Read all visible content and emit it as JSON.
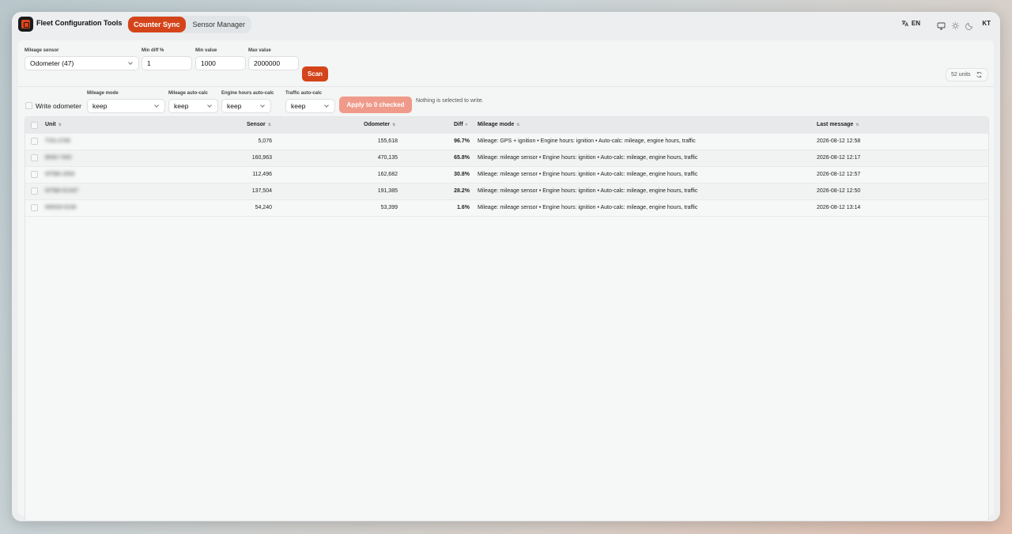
{
  "app": {
    "title": "Fleet Configuration Tools"
  },
  "tabs": [
    {
      "label": "Counter Sync",
      "active": true
    },
    {
      "label": "Sensor Manager",
      "active": false
    }
  ],
  "topbar": {
    "language": "EN",
    "avatar": "KT"
  },
  "filters": {
    "mileage_sensor": {
      "label": "Mileage sensor",
      "value": "Odometer (47)"
    },
    "min_diff": {
      "label": "Min diff %",
      "value": "1"
    },
    "min_value": {
      "label": "Min value",
      "value": "1000"
    },
    "max_value": {
      "label": "Max value",
      "value": "2000000"
    },
    "scan_label": "Scan",
    "units_count": "52 units"
  },
  "write": {
    "write_odometer_label": "Write odometer",
    "mileage_mode": {
      "label": "Mileage mode",
      "value": "keep"
    },
    "mileage_autocalc": {
      "label": "Mileage auto-calc",
      "value": "keep"
    },
    "engine_hours_autocalc": {
      "label": "Engine hours auto-calc",
      "value": "keep"
    },
    "traffic_autocalc": {
      "label": "Traffic auto-calc",
      "value": "keep"
    },
    "apply_label": "Apply to 0 checked",
    "status": "Nothing is selected to write."
  },
  "table": {
    "headers": {
      "unit": "Unit",
      "sensor": "Sensor",
      "odometer": "Odometer",
      "diff": "Diff",
      "mileage_mode": "Mileage mode",
      "last_message": "Last message"
    },
    "rows": [
      {
        "unit": "TSN-3788",
        "sensor": "5,076",
        "odometer": "155,618",
        "diff": "96.7%",
        "mode": "Mileage: GPS + ignition • Engine hours: ignition • Auto-calc: mileage, engine hours, traffic",
        "last": "2026-08-12 12:58"
      },
      {
        "unit": "BNM-7483",
        "sensor": "160,963",
        "odometer": "470,135",
        "diff": "65.8%",
        "mode": "Mileage: mileage sensor • Engine hours: ignition • Auto-calc: mileage, engine hours, traffic",
        "last": "2026-08-12 12:17"
      },
      {
        "unit": "MTBB-2856",
        "sensor": "112,496",
        "odometer": "162,682",
        "diff": "30.8%",
        "mode": "Mileage: mileage sensor • Engine hours: ignition • Auto-calc: mileage, engine hours, traffic",
        "last": "2026-08-12 12:57"
      },
      {
        "unit": "MTBB-R2497",
        "sensor": "137,504",
        "odometer": "191,385",
        "diff": "28.2%",
        "mode": "Mileage: mileage sensor • Engine hours: ignition • Auto-calc: mileage, engine hours, traffic",
        "last": "2026-08-12 12:50"
      },
      {
        "unit": "MRKM-6248",
        "sensor": "54,240",
        "odometer": "53,399",
        "diff": "1.6%",
        "mode": "Mileage: mileage sensor • Engine hours: ignition • Auto-calc: mileage, engine hours, traffic",
        "last": "2026-08-12 13:14"
      }
    ]
  },
  "colors": {
    "accent": "#d4441a",
    "accent_disabled": "#ef9a8a",
    "panel": "#f4f5f5"
  }
}
